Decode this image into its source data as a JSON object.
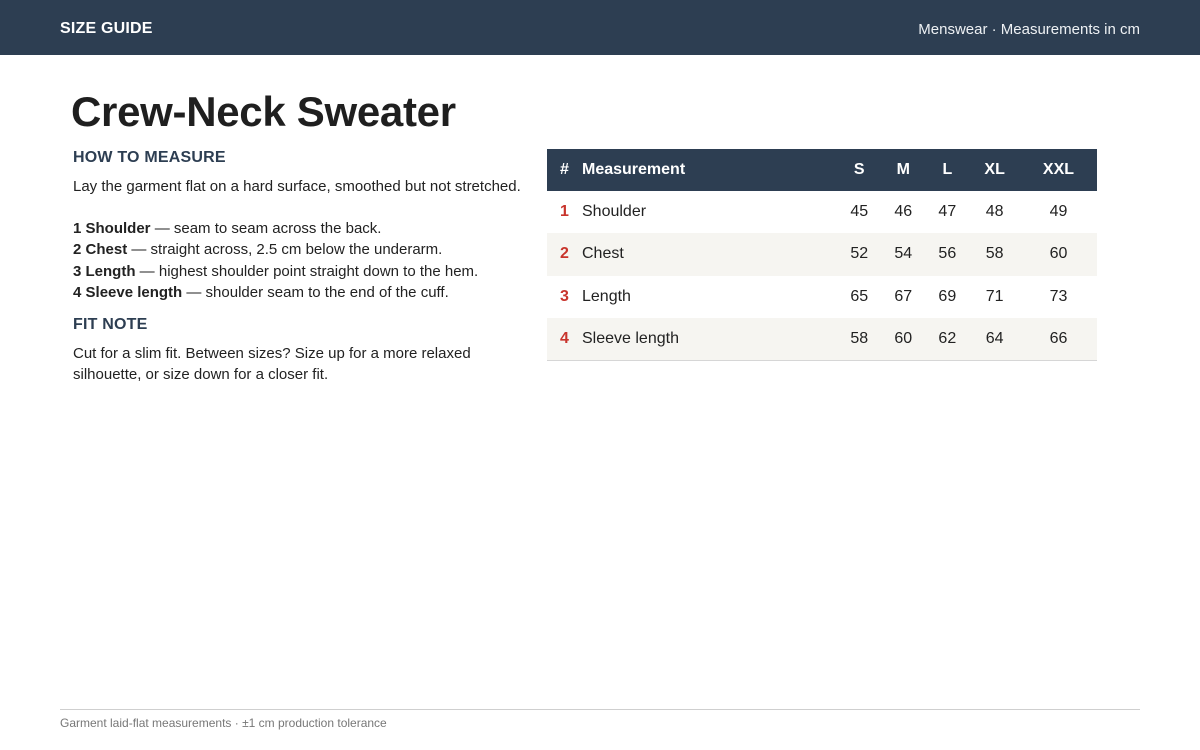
{
  "header": {
    "brand": "SIZE GUIDE",
    "meta": "Menswear · Measurements in cm"
  },
  "page_title": "Crew-Neck Sweater",
  "how_to_measure": {
    "heading": "HOW TO MEASURE",
    "intro": "Lay the garment flat on a hard surface, smoothed but not stretched.",
    "steps": [
      {
        "num": "1",
        "name": "Shoulder",
        "desc": " — seam to seam across the back."
      },
      {
        "num": "2",
        "name": "Chest",
        "desc": " — straight across, 2.5 cm below the underarm."
      },
      {
        "num": "3",
        "name": "Length",
        "desc": " — highest shoulder point straight down to the hem."
      },
      {
        "num": "4",
        "name": "Sleeve length",
        "desc": " — shoulder seam to the end of the cuff."
      }
    ]
  },
  "fit_note": {
    "heading": "FIT NOTE",
    "text": "Cut for a slim fit. Between sizes? Size up for a more relaxed silhouette, or size down for a closer fit."
  },
  "size_table": {
    "headers": [
      "#",
      "Measurement",
      "S",
      "M",
      "L",
      "XL",
      "XXL"
    ],
    "rows": [
      {
        "num": "1",
        "measurement": "Shoulder",
        "values": [
          "45",
          "46",
          "47",
          "48",
          "49"
        ]
      },
      {
        "num": "2",
        "measurement": "Chest",
        "values": [
          "52",
          "54",
          "56",
          "58",
          "60"
        ]
      },
      {
        "num": "3",
        "measurement": "Length",
        "values": [
          "65",
          "67",
          "69",
          "71",
          "73"
        ]
      },
      {
        "num": "4",
        "measurement": "Sleeve length",
        "values": [
          "58",
          "60",
          "62",
          "64",
          "66"
        ]
      }
    ]
  },
  "footer": {
    "note": "Garment laid-flat measurements · ±1 cm production tolerance"
  },
  "colors": {
    "header_bg": "#2d3e52",
    "accent_red": "#c8342c",
    "row_stripe": "#f6f5f1"
  }
}
